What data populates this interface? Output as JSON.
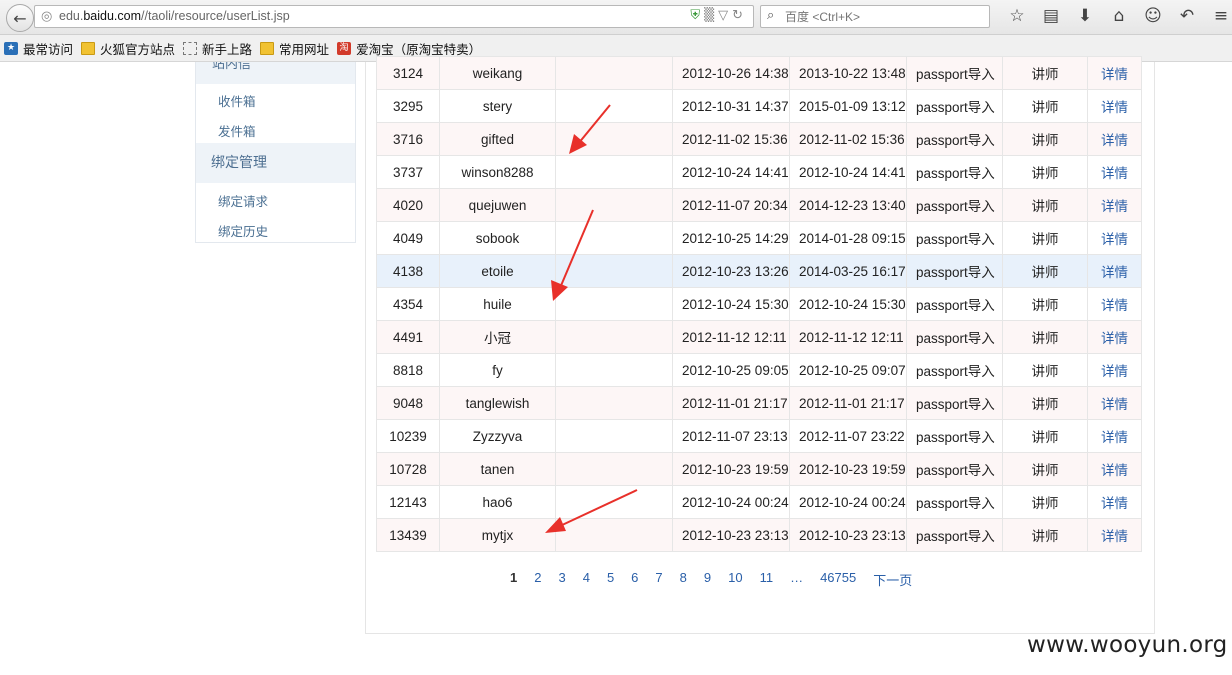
{
  "browser": {
    "url_host": "edu.baidu.com",
    "url_prefix": "edu.",
    "url_domain": "baidu.com",
    "url_path": "//taoli/resource/userList.jsp",
    "search_placeholder": "百度 <Ctrl+K>"
  },
  "bookmarks": [
    {
      "label": "最常访问",
      "icon": "star"
    },
    {
      "label": "火狐官方站点",
      "icon": "folder"
    },
    {
      "label": "新手上路",
      "icon": "page"
    },
    {
      "label": "常用网址",
      "icon": "folder"
    },
    {
      "label": "爱淘宝（原淘宝特卖）",
      "icon": "tao"
    }
  ],
  "sidebar": {
    "top_header": "站内信",
    "inbox": "收件箱",
    "outbox": "发件箱",
    "group": "绑定管理",
    "bind_request": "绑定请求",
    "bind_history": "绑定历史"
  },
  "table": {
    "rows": [
      {
        "id": "3124",
        "name": "weikang",
        "extra": "",
        "created": "2012-10-26 14:38",
        "login": "2013-10-22 13:48",
        "source": "passport导入",
        "role": "讲师",
        "detail": "详情"
      },
      {
        "id": "3295",
        "name": "stery",
        "extra": "",
        "created": "2012-10-31 14:37",
        "login": "2015-01-09 13:12",
        "source": "passport导入",
        "role": "讲师",
        "detail": "详情"
      },
      {
        "id": "3716",
        "name": "gifted",
        "extra": "",
        "created": "2012-11-02 15:36",
        "login": "2012-11-02 15:36",
        "source": "passport导入",
        "role": "讲师",
        "detail": "详情"
      },
      {
        "id": "3737",
        "name": "winson8288",
        "extra": "",
        "created": "2012-10-24 14:41",
        "login": "2012-10-24 14:41",
        "source": "passport导入",
        "role": "讲师",
        "detail": "详情"
      },
      {
        "id": "4020",
        "name": "quejuwen",
        "extra": "",
        "created": "2012-11-07 20:34",
        "login": "2014-12-23 13:40",
        "source": "passport导入",
        "role": "讲师",
        "detail": "详情"
      },
      {
        "id": "4049",
        "name": "sobook",
        "extra": "",
        "created": "2012-10-25 14:29",
        "login": "2014-01-28 09:15",
        "source": "passport导入",
        "role": "讲师",
        "detail": "详情"
      },
      {
        "id": "4138",
        "name": "etoile",
        "extra": "",
        "created": "2012-10-23 13:26",
        "login": "2014-03-25 16:17",
        "source": "passport导入",
        "role": "讲师",
        "detail": "详情",
        "highlight": true
      },
      {
        "id": "4354",
        "name": "huile",
        "extra": "",
        "created": "2012-10-24 15:30",
        "login": "2012-10-24 15:30",
        "source": "passport导入",
        "role": "讲师",
        "detail": "详情"
      },
      {
        "id": "4491",
        "name": "小冠",
        "extra": "",
        "created": "2012-11-12 12:11",
        "login": "2012-11-12 12:11",
        "source": "passport导入",
        "role": "讲师",
        "detail": "详情"
      },
      {
        "id": "8818",
        "name": "fy",
        "extra": "",
        "created": "2012-10-25 09:05",
        "login": "2012-10-25 09:07",
        "source": "passport导入",
        "role": "讲师",
        "detail": "详情"
      },
      {
        "id": "9048",
        "name": "tanglewish",
        "extra": "",
        "created": "2012-11-01 21:17",
        "login": "2012-11-01 21:17",
        "source": "passport导入",
        "role": "讲师",
        "detail": "详情"
      },
      {
        "id": "10239",
        "name": "Zyzzyva",
        "extra": "",
        "created": "2012-11-07 23:13",
        "login": "2012-11-07 23:22",
        "source": "passport导入",
        "role": "讲师",
        "detail": "详情"
      },
      {
        "id": "10728",
        "name": "tanen",
        "extra": "",
        "created": "2012-10-23 19:59",
        "login": "2012-10-23 19:59",
        "source": "passport导入",
        "role": "讲师",
        "detail": "详情"
      },
      {
        "id": "12143",
        "name": "hao6",
        "extra": "",
        "created": "2012-10-24 00:24",
        "login": "2012-10-24 00:24",
        "source": "passport导入",
        "role": "讲师",
        "detail": "详情"
      },
      {
        "id": "13439",
        "name": "mytjx",
        "extra": "",
        "created": "2012-10-23 23:13",
        "login": "2012-10-23 23:13",
        "source": "passport导入",
        "role": "讲师",
        "detail": "详情"
      }
    ]
  },
  "pagination": {
    "current": "1",
    "pages": [
      "2",
      "3",
      "4",
      "5",
      "6",
      "7",
      "8",
      "9",
      "10",
      "11"
    ],
    "ellipsis": "…",
    "last": "46755",
    "next": "下一页"
  },
  "watermark": "www.wooyun.org",
  "colors": {
    "link": "#2a5fa8",
    "annotation_arrow": "#e8302a",
    "row_highlight": "#e8f1fb"
  }
}
